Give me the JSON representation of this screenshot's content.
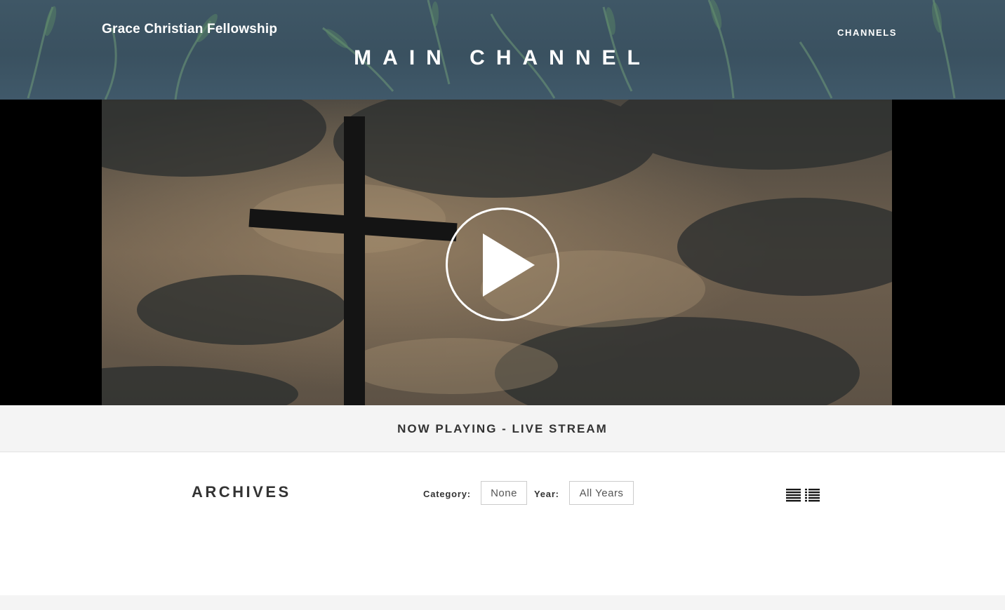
{
  "header": {
    "brand": "Grace Christian Fellowship",
    "nav_channels": "CHANNELS",
    "title": "MAIN CHANNEL"
  },
  "video": {
    "play_icon": "play-icon"
  },
  "now_playing": {
    "label": "NOW PLAYING - LIVE STREAM"
  },
  "archives": {
    "title": "ARCHIVES",
    "category_label": "Category:",
    "category_value": "None",
    "year_label": "Year:",
    "year_value": "All Years",
    "views": [
      {
        "icon": "list-view-icon"
      },
      {
        "icon": "detail-list-view-icon"
      }
    ]
  },
  "colors": {
    "header_bg": "#3f5766",
    "now_playing_bg": "#f4f4f4",
    "text_dark": "#333333"
  }
}
